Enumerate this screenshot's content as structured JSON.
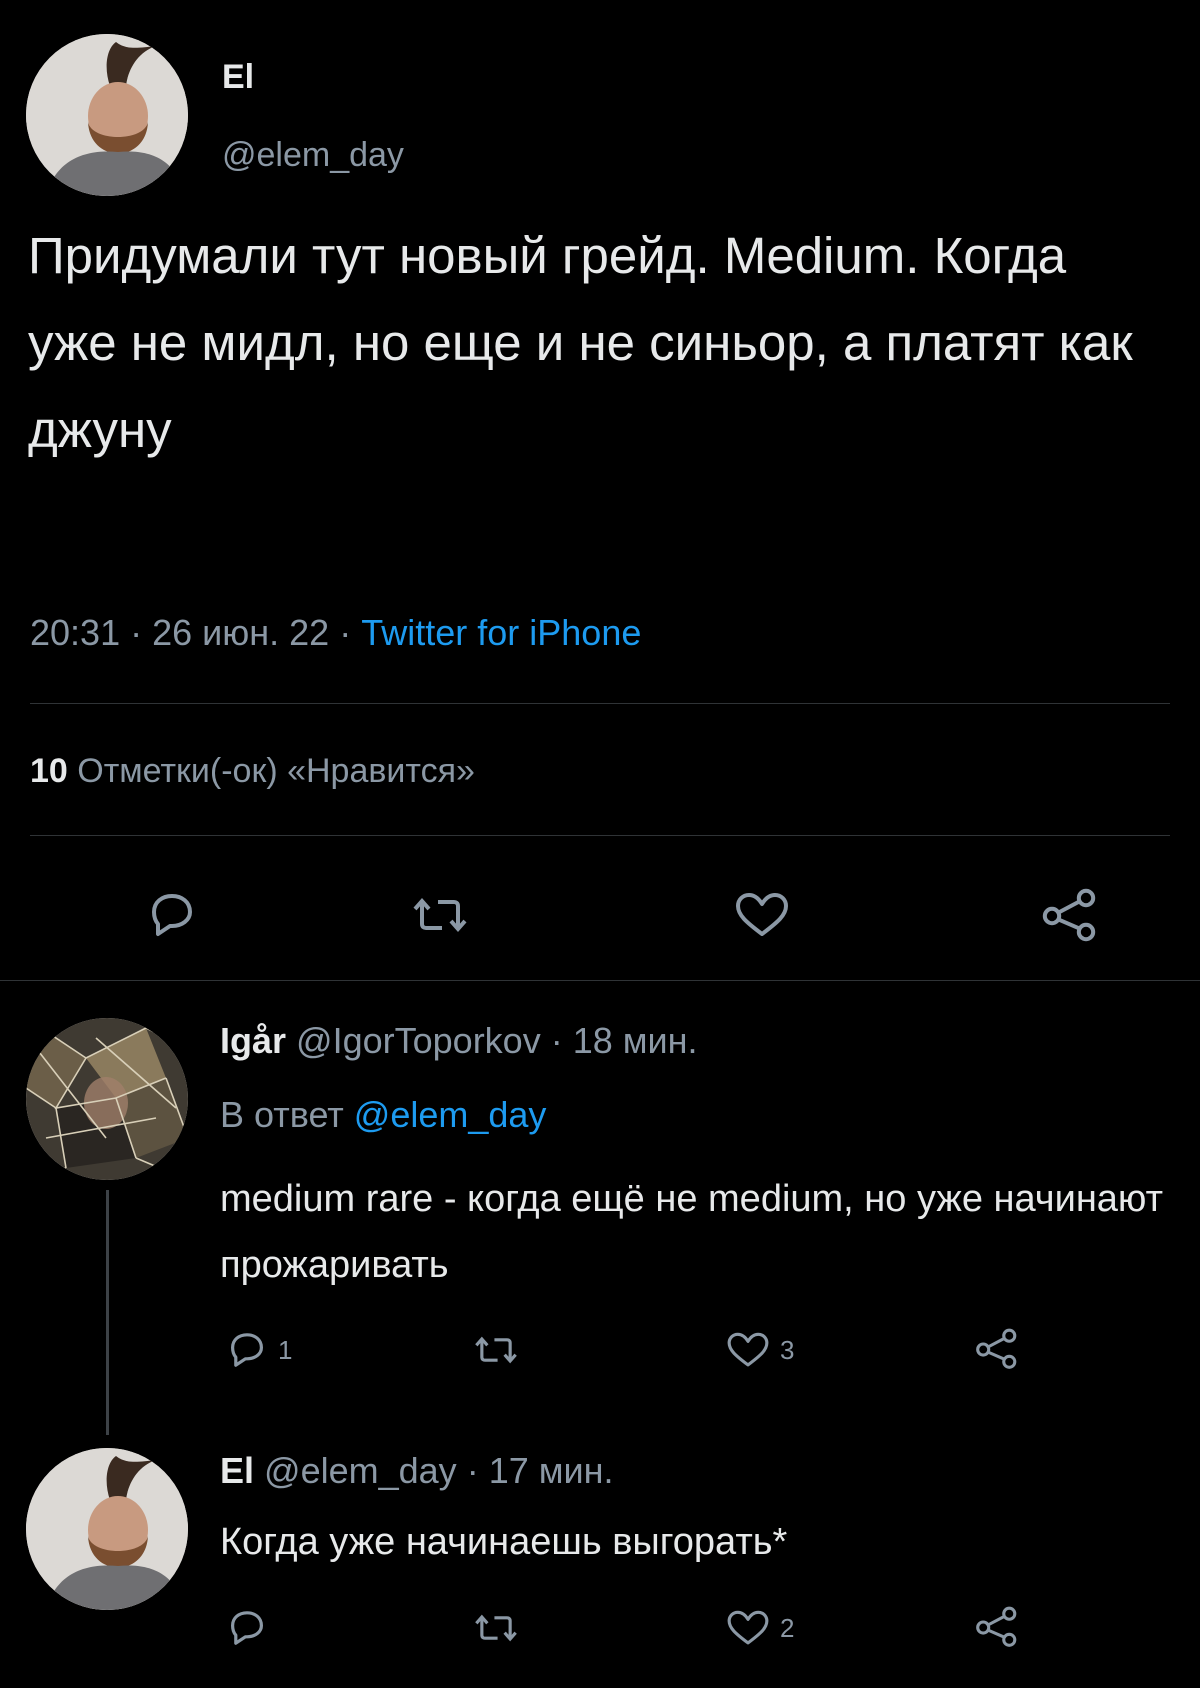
{
  "main_tweet": {
    "display_name": "El",
    "handle": "@elem_day",
    "text": "Придумали тут новый грейд. Medium. Когда уже не мидл, но еще и не синьор, а платят как джуну",
    "time": "20:31",
    "date": "26 июн. 22",
    "source": "Twitter for iPhone",
    "likes_count": "10",
    "likes_label": "Отметки(-ок) «Нравится»"
  },
  "replies": [
    {
      "display_name": "Igår",
      "handle": "@IgorToporkov",
      "age": "18 мин.",
      "reply_to_prefix": "В ответ",
      "reply_to_handle": "@elem_day",
      "text": "medium rare - когда ещё не medium, но уже начинают прожаривать",
      "reply_count": "1",
      "retweet_count": "",
      "like_count": "3"
    },
    {
      "display_name": "El",
      "handle": "@elem_day",
      "age": "17 мин.",
      "text": "Когда уже начинаешь выгорать*",
      "reply_count": "",
      "retweet_count": "",
      "like_count": "2"
    }
  ],
  "separator": "·",
  "icons": [
    "reply-icon",
    "retweet-icon",
    "like-icon",
    "share-icon"
  ],
  "colors": {
    "background": "#000000",
    "text": "#e7e9ea",
    "muted": "#8b98a5",
    "link": "#1d9bf0",
    "divider": "#2f3336"
  }
}
